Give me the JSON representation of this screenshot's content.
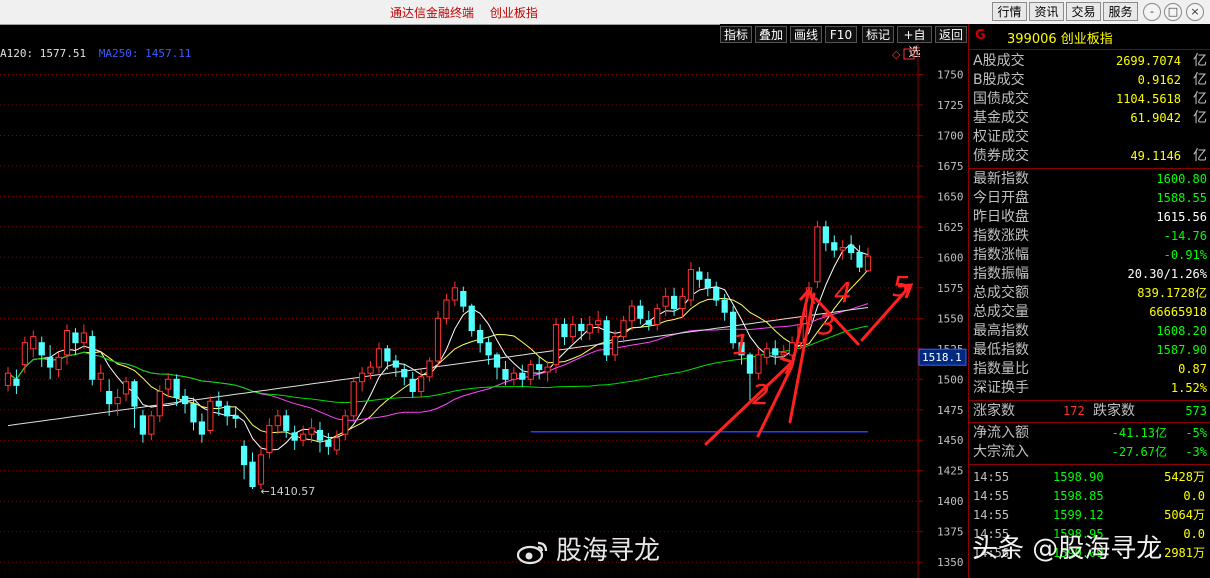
{
  "app_title": [
    "通达信金融终端",
    "创业板指"
  ],
  "top_buttons": [
    "行情",
    "资讯",
    "交易",
    "服务"
  ],
  "window_buttons": [
    "-",
    "□",
    "×"
  ],
  "toolbar": [
    "指标",
    "叠加",
    "画线",
    "F10",
    "标记",
    "+自选",
    "返回"
  ],
  "ma_legend": [
    {
      "text": "A120: 1577.51",
      "color": "#e0e0e0"
    },
    {
      "text": "MA250: 1457.11",
      "color": "#3a5cff"
    }
  ],
  "y_ticks": [
    "1750",
    "1725",
    "1700",
    "1675",
    "1650",
    "1625",
    "1600",
    "1575",
    "1550",
    "1525",
    "1500",
    "1475",
    "1450",
    "1425",
    "1400",
    "1375",
    "1350"
  ],
  "current_price_label": "1518.1",
  "low_annotation": "1410.57",
  "handwritten_marks": [
    "1",
    "2",
    "3",
    "4",
    "5"
  ],
  "panel": {
    "g": "G",
    "code_name": "399006 创业板指"
  },
  "turnover_rows": [
    {
      "label": "A股成交",
      "value": "2699.7074",
      "unit": "亿",
      "color": "#ffff00"
    },
    {
      "label": "B股成交",
      "value": "0.9162",
      "unit": "亿",
      "color": "#ffff00"
    },
    {
      "label": "国债成交",
      "value": "1104.5618",
      "unit": "亿",
      "color": "#ffff00"
    },
    {
      "label": "基金成交",
      "value": "61.9042",
      "unit": "亿",
      "color": "#ffff00"
    },
    {
      "label": "权证成交",
      "value": "",
      "unit": "",
      "color": "#ffff00"
    },
    {
      "label": "债券成交",
      "value": "49.1146",
      "unit": "亿",
      "color": "#ffff00"
    }
  ],
  "index_rows": [
    {
      "label": "最新指数",
      "value": "1600.80",
      "color": "#00ff00"
    },
    {
      "label": "今日开盘",
      "value": "1588.55",
      "color": "#00ff00"
    },
    {
      "label": "昨日收盘",
      "value": "1615.56",
      "color": "#ffffff"
    },
    {
      "label": "指数涨跌",
      "value": "-14.76",
      "color": "#00ff00"
    },
    {
      "label": "指数涨幅",
      "value": "-0.91%",
      "color": "#00ff00"
    },
    {
      "label": "指数振幅",
      "value": "20.30/1.26%",
      "color": "#ffffff"
    },
    {
      "label": "总成交额",
      "value": "839.1728亿",
      "color": "#ffff00"
    },
    {
      "label": "总成交量",
      "value": "66665918",
      "color": "#ffff00"
    },
    {
      "label": "最高指数",
      "value": "1608.20",
      "color": "#00ff00"
    },
    {
      "label": "最低指数",
      "value": "1587.90",
      "color": "#00ff00"
    },
    {
      "label": "指数量比",
      "value": "0.87",
      "color": "#ffff00"
    },
    {
      "label": "深证换手",
      "value": "1.52%",
      "color": "#ffff00"
    }
  ],
  "breadth": {
    "up_label": "涨家数",
    "up": "172",
    "down_label": "跌家数",
    "down": "573"
  },
  "flow_rows": [
    {
      "label": "净流入额",
      "value": "-41.13亿",
      "pct": "-5%"
    },
    {
      "label": "大宗流入",
      "value": "-27.67亿",
      "pct": "-3%"
    }
  ],
  "ticks": [
    {
      "time": "14:55",
      "price": "1598.90",
      "vol": "5428万"
    },
    {
      "time": "14:55",
      "price": "1598.85",
      "vol": "0.0"
    },
    {
      "time": "14:55",
      "price": "1599.12",
      "vol": "5064万"
    },
    {
      "time": "14:55",
      "price": "1598.95",
      "vol": "0.0"
    },
    {
      "time": "14:56",
      "price": "1599.09",
      "vol": "2981万"
    }
  ],
  "watermark_center": "股海寻龙",
  "watermark_corner": "头条 @股海寻龙",
  "colors": {
    "up": "#ff3232",
    "down": "#54ffff",
    "grid": "#8b0000",
    "ma_white": "#ffffff",
    "ma_yellow": "#ffff66",
    "ma_magenta": "#ff44ff",
    "ma_green": "#00dd00",
    "ma_blue": "#2a3cff"
  },
  "chart_data": {
    "type": "candlestick",
    "y_axis_ticks": [
      1750,
      1725,
      1700,
      1675,
      1650,
      1625,
      1600,
      1575,
      1550,
      1525,
      1500,
      1475,
      1450,
      1425,
      1400,
      1375,
      1350
    ],
    "ylim": [
      1337,
      1775
    ],
    "candles": [
      [
        1495,
        1505,
        1490,
        1510
      ],
      [
        1500,
        1495,
        1488,
        1508
      ],
      [
        1512,
        1530,
        1505,
        1535
      ],
      [
        1525,
        1535,
        1518,
        1540
      ],
      [
        1530,
        1520,
        1510,
        1535
      ],
      [
        1518,
        1510,
        1500,
        1528
      ],
      [
        1508,
        1518,
        1502,
        1522
      ],
      [
        1520,
        1540,
        1512,
        1545
      ],
      [
        1538,
        1530,
        1520,
        1542
      ],
      [
        1530,
        1538,
        1525,
        1545
      ],
      [
        1535,
        1500,
        1495,
        1540
      ],
      [
        1500,
        1505,
        1490,
        1512
      ],
      [
        1490,
        1480,
        1470,
        1500
      ],
      [
        1480,
        1485,
        1470,
        1492
      ],
      [
        1488,
        1498,
        1482,
        1502
      ],
      [
        1498,
        1478,
        1460,
        1500
      ],
      [
        1470,
        1455,
        1448,
        1475
      ],
      [
        1455,
        1470,
        1450,
        1474
      ],
      [
        1470,
        1490,
        1465,
        1495
      ],
      [
        1492,
        1500,
        1485,
        1505
      ],
      [
        1500,
        1485,
        1478,
        1504
      ],
      [
        1486,
        1480,
        1472,
        1492
      ],
      [
        1480,
        1465,
        1458,
        1485
      ],
      [
        1465,
        1455,
        1448,
        1472
      ],
      [
        1458,
        1482,
        1455,
        1486
      ],
      [
        1482,
        1478,
        1470,
        1490
      ],
      [
        1478,
        1470,
        1462,
        1482
      ],
      [
        1470,
        1468,
        1460,
        1478
      ],
      [
        1445,
        1430,
        1418,
        1450
      ],
      [
        1432,
        1412,
        1410,
        1440
      ],
      [
        1414,
        1438,
        1410,
        1445
      ],
      [
        1440,
        1462,
        1435,
        1468
      ],
      [
        1462,
        1470,
        1455,
        1475
      ],
      [
        1470,
        1458,
        1452,
        1475
      ],
      [
        1456,
        1450,
        1442,
        1462
      ],
      [
        1450,
        1455,
        1445,
        1462
      ],
      [
        1455,
        1460,
        1448,
        1468
      ],
      [
        1458,
        1450,
        1440,
        1465
      ],
      [
        1450,
        1445,
        1438,
        1456
      ],
      [
        1442,
        1452,
        1438,
        1458
      ],
      [
        1455,
        1470,
        1450,
        1475
      ],
      [
        1470,
        1498,
        1465,
        1502
      ],
      [
        1498,
        1505,
        1490,
        1510
      ],
      [
        1505,
        1510,
        1500,
        1515
      ],
      [
        1510,
        1525,
        1505,
        1530
      ],
      [
        1525,
        1515,
        1508,
        1528
      ],
      [
        1515,
        1510,
        1502,
        1520
      ],
      [
        1508,
        1502,
        1495,
        1512
      ],
      [
        1500,
        1490,
        1485,
        1506
      ],
      [
        1490,
        1502,
        1485,
        1508
      ],
      [
        1502,
        1515,
        1498,
        1518
      ],
      [
        1515,
        1550,
        1510,
        1556
      ],
      [
        1550,
        1565,
        1545,
        1570
      ],
      [
        1565,
        1575,
        1560,
        1580
      ],
      [
        1572,
        1560,
        1555,
        1576
      ],
      [
        1560,
        1540,
        1535,
        1562
      ],
      [
        1540,
        1530,
        1522,
        1545
      ],
      [
        1530,
        1520,
        1512,
        1535
      ],
      [
        1520,
        1510,
        1500,
        1522
      ],
      [
        1508,
        1500,
        1495,
        1515
      ],
      [
        1500,
        1505,
        1495,
        1510
      ],
      [
        1505,
        1500,
        1494,
        1512
      ],
      [
        1500,
        1512,
        1495,
        1516
      ],
      [
        1512,
        1508,
        1500,
        1518
      ],
      [
        1506,
        1510,
        1498,
        1515
      ],
      [
        1512,
        1545,
        1505,
        1550
      ],
      [
        1545,
        1535,
        1528,
        1550
      ],
      [
        1535,
        1545,
        1530,
        1552
      ],
      [
        1545,
        1540,
        1532,
        1550
      ],
      [
        1538,
        1545,
        1532,
        1552
      ],
      [
        1545,
        1548,
        1538,
        1556
      ],
      [
        1548,
        1520,
        1515,
        1552
      ],
      [
        1520,
        1535,
        1515,
        1540
      ],
      [
        1535,
        1548,
        1530,
        1552
      ],
      [
        1548,
        1560,
        1540,
        1565
      ],
      [
        1560,
        1550,
        1545,
        1565
      ],
      [
        1548,
        1545,
        1540,
        1556
      ],
      [
        1545,
        1558,
        1540,
        1562
      ],
      [
        1560,
        1568,
        1552,
        1575
      ],
      [
        1568,
        1558,
        1552,
        1575
      ],
      [
        1558,
        1568,
        1550,
        1575
      ],
      [
        1565,
        1590,
        1560,
        1596
      ],
      [
        1588,
        1582,
        1575,
        1592
      ],
      [
        1582,
        1575,
        1568,
        1588
      ],
      [
        1575,
        1565,
        1560,
        1580
      ],
      [
        1565,
        1555,
        1548,
        1570
      ],
      [
        1555,
        1530,
        1525,
        1560
      ],
      [
        1530,
        1520,
        1512,
        1535
      ],
      [
        1520,
        1505,
        1480,
        1522
      ],
      [
        1505,
        1520,
        1500,
        1525
      ],
      [
        1518,
        1525,
        1512,
        1530
      ],
      [
        1525,
        1520,
        1512,
        1532
      ],
      [
        1520,
        1522,
        1515,
        1528
      ],
      [
        1520,
        1530,
        1515,
        1535
      ],
      [
        1530,
        1545,
        1525,
        1550
      ],
      [
        1545,
        1575,
        1540,
        1580
      ],
      [
        1580,
        1625,
        1575,
        1630
      ],
      [
        1625,
        1612,
        1605,
        1630
      ],
      [
        1612,
        1606,
        1600,
        1618
      ],
      [
        1606,
        1608,
        1598,
        1614
      ],
      [
        1610,
        1604,
        1598,
        1618
      ],
      [
        1604,
        1592,
        1588,
        1610
      ],
      [
        1589,
        1601,
        1588,
        1608
      ]
    ]
  }
}
